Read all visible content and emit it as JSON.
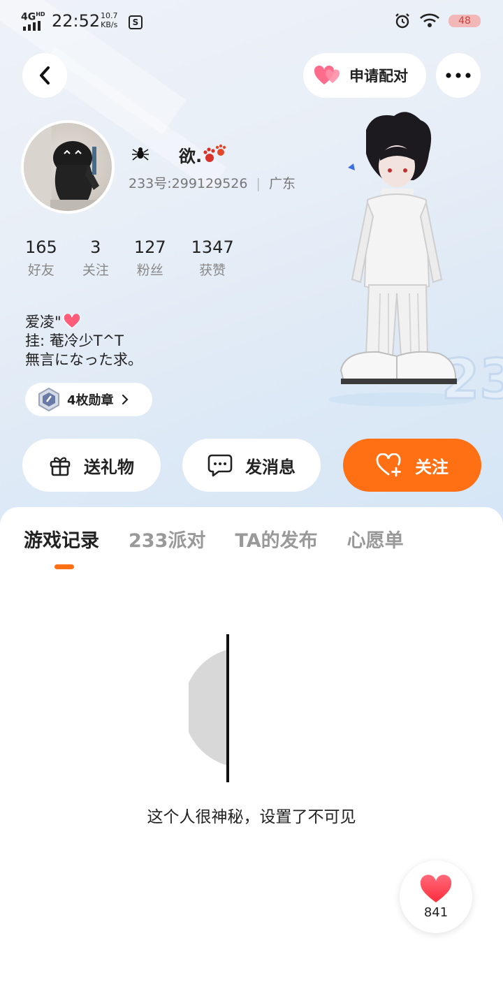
{
  "status_bar": {
    "network": "4G",
    "network_sup": "HD",
    "time": "22:52",
    "speed_value": "10.7",
    "speed_unit": "KB/s",
    "battery": "48",
    "icons": [
      "signal-icon",
      "s-app-icon",
      "alarm-icon",
      "wifi-icon",
      "battery-icon"
    ]
  },
  "header": {
    "back_icon": "chevron-left-icon",
    "pair_label": "申请配对",
    "pair_icon": "double-heart-icon",
    "more_icon": "more-dots-icon"
  },
  "profile": {
    "username": "欲.",
    "prefix_icon": "spider-icon",
    "suffix_icon": "paw-icon",
    "id_line": "233号:299129526",
    "location": "广东",
    "stats": [
      {
        "num": "165",
        "label": "好友"
      },
      {
        "num": "3",
        "label": "关注"
      },
      {
        "num": "127",
        "label": "粉丝"
      },
      {
        "num": "1347",
        "label": "获赞"
      }
    ],
    "bio_lines": [
      "爱凌\"",
      "挂: 菴冷少T^T",
      "無言になった求。"
    ],
    "medal_label": "4枚勋章",
    "medal_icon": "medal-icon"
  },
  "actions": {
    "gift_label": "送礼物",
    "message_label": "发消息",
    "follow_label": "关注"
  },
  "tabs": [
    {
      "label": "游戏记录",
      "active": true
    },
    {
      "label": "233派对",
      "active": false
    },
    {
      "label": "TA的发布",
      "active": false
    },
    {
      "label": "心愿单",
      "active": false
    }
  ],
  "content": {
    "empty_message": "这个人很神秘，设置了不可见"
  },
  "like": {
    "count": "841"
  },
  "colors": {
    "accent": "#ff7014",
    "heart": "#ff4d6d",
    "background_top": "#e6eef8"
  }
}
